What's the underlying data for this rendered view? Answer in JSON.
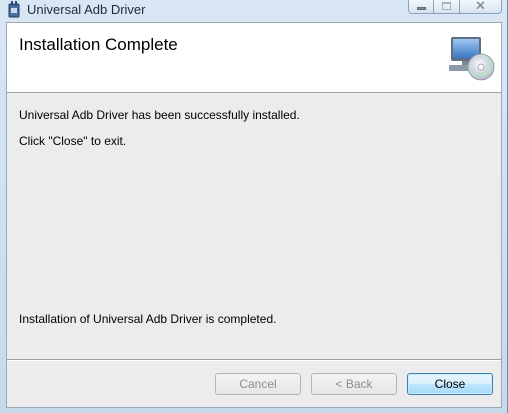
{
  "window": {
    "title": "Universal Adb Driver"
  },
  "caption_buttons": {
    "minimize_icon": "minimize-icon",
    "maximize_icon": "maximize-icon",
    "close_glyph": "✕"
  },
  "header": {
    "title": "Installation Complete",
    "icon": "computer-cd-icon"
  },
  "body": {
    "line1": "Universal Adb Driver has been successfully installed.",
    "line2": "Click \"Close\" to exit.",
    "line3": "Installation of Universal Adb Driver is completed."
  },
  "buttons": {
    "cancel_label": "Cancel",
    "back_label": "< Back",
    "close_label": "Close",
    "cancel_enabled": false,
    "back_enabled": false,
    "close_enabled": true
  },
  "colors": {
    "frame": "#c6daec",
    "client_bg": "#ececec",
    "banner_bg": "#ffffff",
    "default_button_border": "#3c7fb1"
  }
}
